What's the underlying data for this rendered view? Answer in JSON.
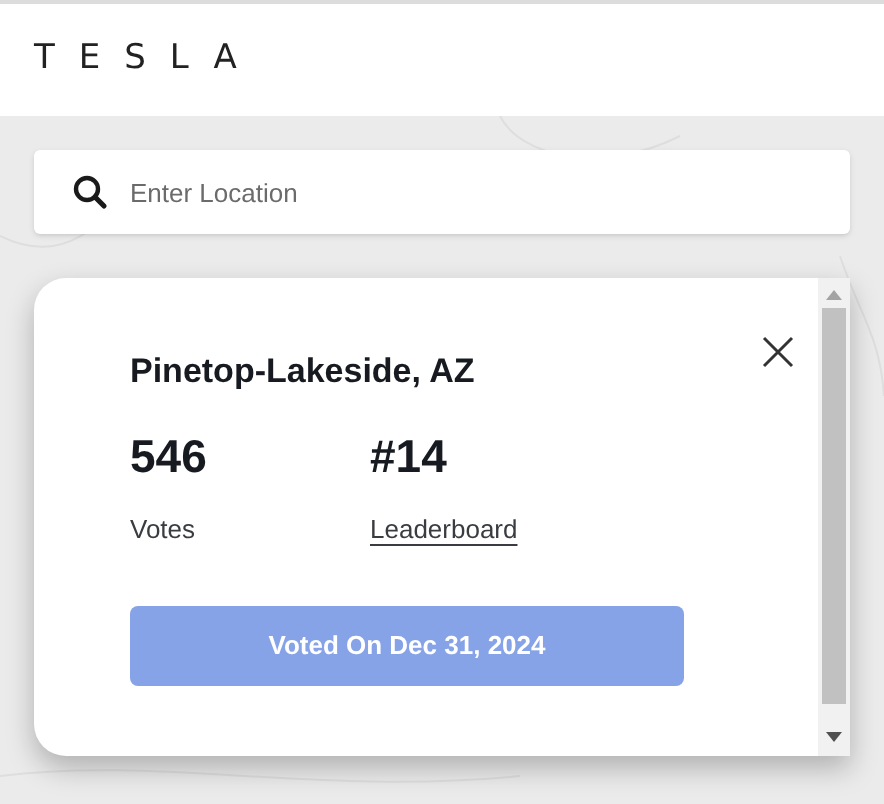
{
  "header": {
    "logo": "TESLA"
  },
  "search": {
    "placeholder": "Enter Location"
  },
  "card": {
    "title": "Pinetop-Lakeside, AZ",
    "stats": [
      {
        "value": "546",
        "label": "Votes",
        "kind": "text"
      },
      {
        "value": "#14",
        "label": "Leaderboard",
        "kind": "link"
      }
    ],
    "button": {
      "label": "Voted On Dec 31, 2024",
      "disabled": true
    }
  }
}
